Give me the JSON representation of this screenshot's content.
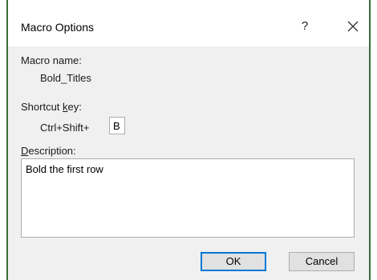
{
  "dialog": {
    "title": "Macro Options",
    "help_label": "?",
    "close_icon": "close-icon"
  },
  "macro_name": {
    "label": "Macro name:",
    "value": "Bold_Titles"
  },
  "shortcut": {
    "label_pre": "Shortcut ",
    "label_accel": "k",
    "label_post": "ey:",
    "prefix": "Ctrl+Shift+ ",
    "key_value": "B"
  },
  "description": {
    "label_accel": "D",
    "label_rest": "escription:",
    "value": "Bold the first row"
  },
  "buttons": {
    "ok": "OK",
    "cancel": "Cancel"
  },
  "colors": {
    "frame": "#3a6b35",
    "dialog_bg": "#f0f0f0",
    "default_button_border": "#0078d7"
  }
}
